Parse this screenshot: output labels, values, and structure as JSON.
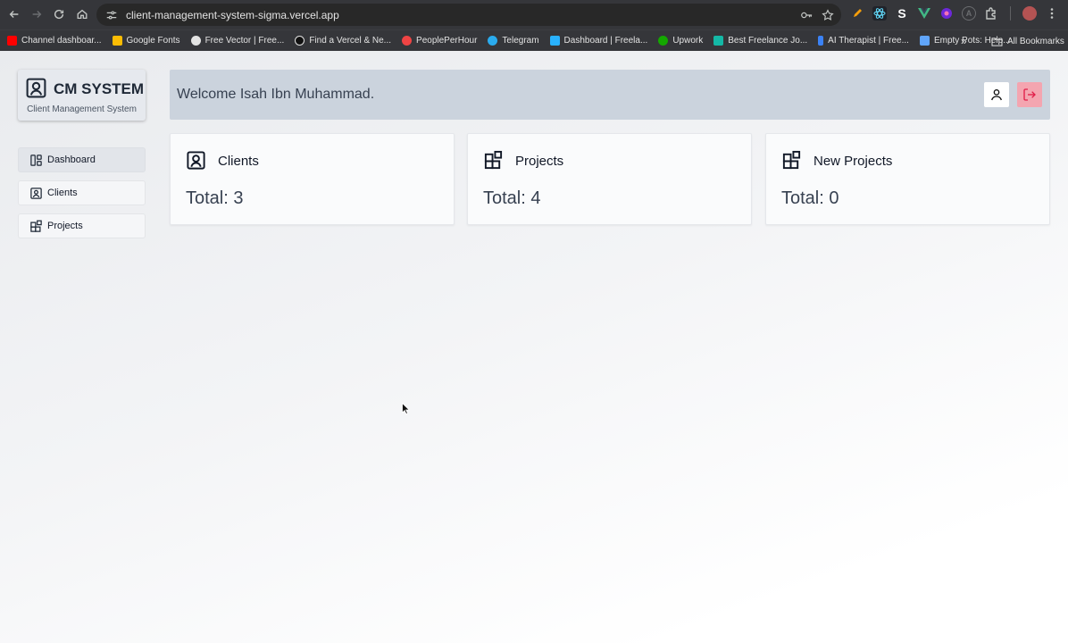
{
  "browser": {
    "url": "client-management-system-sigma.vercel.app",
    "bookmarks": [
      {
        "label": "Channel dashboar...",
        "color": "#ff0000"
      },
      {
        "label": "Google Fonts",
        "color": "#fbbc04"
      },
      {
        "label": "Free Vector | Free...",
        "color": "#e3e3e3"
      },
      {
        "label": "Find a Vercel & Ne...",
        "color": "#111111"
      },
      {
        "label": "PeoplePerHour",
        "color": "#ef4444"
      },
      {
        "label": "Telegram",
        "color": "#2aabee"
      },
      {
        "label": "Dashboard | Freela...",
        "color": "#29b2fe"
      },
      {
        "label": "Upwork",
        "color": "#14a800"
      },
      {
        "label": "Best Freelance Jo...",
        "color": "#14b8a6"
      },
      {
        "label": "AI Therapist | Free...",
        "color": "#3b82f6"
      },
      {
        "label": "Empty Pots: Help...",
        "color": "#60a5fa"
      }
    ],
    "all_bookmarks": "All Bookmarks"
  },
  "sidebar": {
    "brand_title": "CM SYSTEM",
    "brand_subtitle": "Client Management System",
    "items": [
      {
        "label": "Dashboard",
        "icon": "dashboard-icon",
        "active": true
      },
      {
        "label": "Clients",
        "icon": "user-square-icon",
        "active": false
      },
      {
        "label": "Projects",
        "icon": "blocks-icon",
        "active": false
      }
    ]
  },
  "header": {
    "welcome": "Welcome Isah Ibn Muhammad."
  },
  "cards": [
    {
      "title": "Clients",
      "total": "Total: 3",
      "icon": "user-square-icon"
    },
    {
      "title": "Projects",
      "total": "Total: 4",
      "icon": "blocks-icon"
    },
    {
      "title": "New Projects",
      "total": "Total: 0",
      "icon": "blocks-icon"
    }
  ],
  "colors": {
    "header_bg": "#cbd3dd",
    "logout_bg": "#f4a5b0",
    "logout_icon": "#e11d48"
  }
}
